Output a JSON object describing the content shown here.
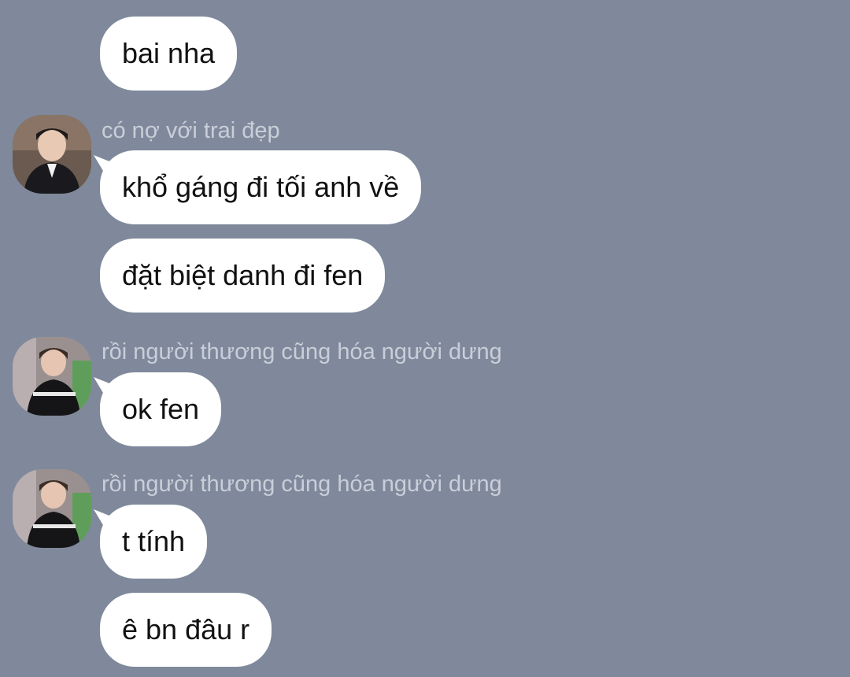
{
  "chat": {
    "messages": [
      {
        "text": "bai nha"
      },
      {
        "sender": "có nợ với trai đẹp",
        "avatar": "avatar-portrait-icon",
        "text": "khổ gáng đi tối anh về"
      },
      {
        "text": "đặt biệt danh đi fen"
      },
      {
        "sender": "rồi người thương cũng hóa người dưng",
        "avatar": "avatar-portrait-icon",
        "text": "ok fen"
      },
      {
        "sender": "rồi người thương cũng hóa người dưng",
        "avatar": "avatar-portrait-icon",
        "text": "t tính"
      },
      {
        "text": "ê bn đâu r"
      }
    ]
  },
  "colors": {
    "background": "#7f899b",
    "bubble": "#ffffff",
    "sender_name": "#c9ced8"
  }
}
